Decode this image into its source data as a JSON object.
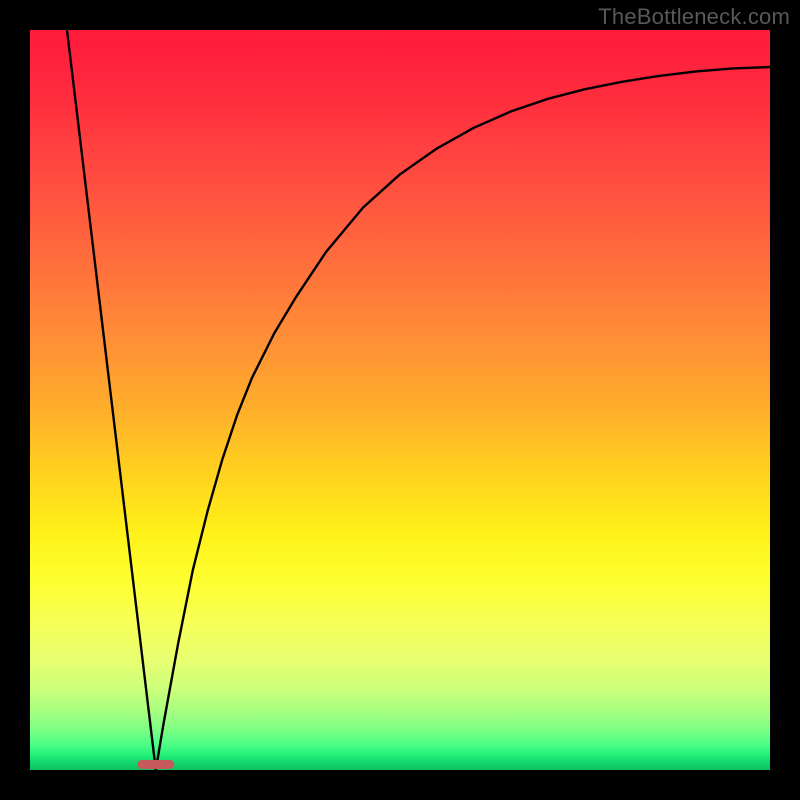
{
  "watermark": "TheBottleneck.com",
  "chart_data": {
    "type": "line",
    "title": "",
    "xlabel": "",
    "ylabel": "",
    "xlim": [
      0,
      100
    ],
    "ylim": [
      0,
      100
    ],
    "grid": false,
    "legend": false,
    "notch_marker": {
      "x": 17,
      "color": "#c65a5a",
      "width": 5
    },
    "series": [
      {
        "name": "left-line",
        "x": [
          5,
          17
        ],
        "y": [
          100,
          0
        ]
      },
      {
        "name": "right-curve",
        "x": [
          17,
          18,
          20,
          22,
          24,
          26,
          28,
          30,
          33,
          36,
          40,
          45,
          50,
          55,
          60,
          65,
          70,
          75,
          80,
          85,
          90,
          95,
          100
        ],
        "y": [
          0,
          6,
          17,
          27,
          35,
          42,
          48,
          53,
          59,
          64,
          70,
          76,
          80.5,
          84,
          86.8,
          89,
          90.7,
          92,
          93,
          93.8,
          94.4,
          94.8,
          95
        ]
      }
    ]
  }
}
